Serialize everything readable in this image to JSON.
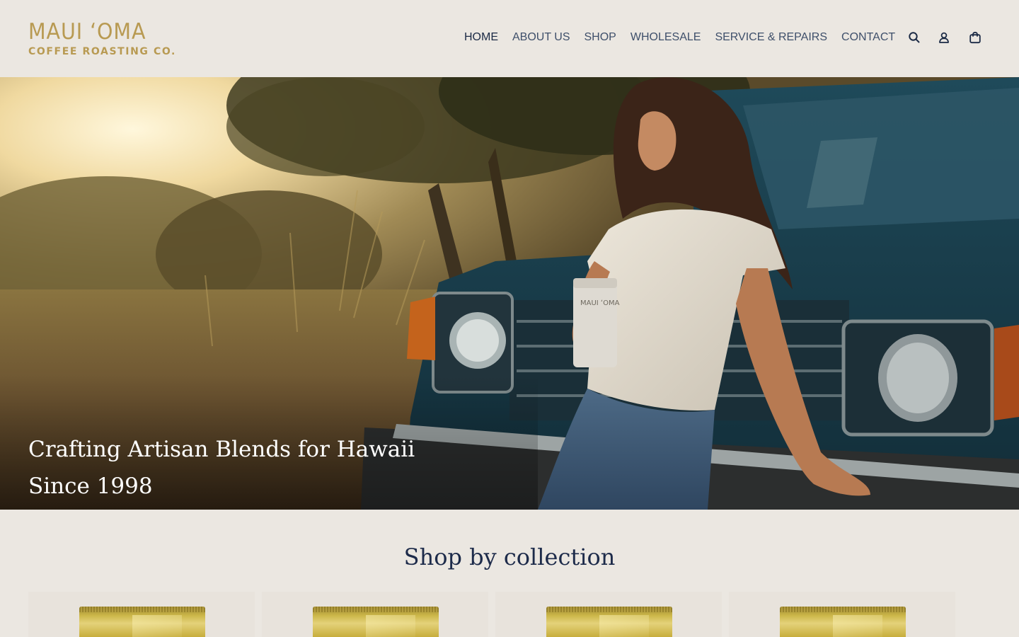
{
  "brand": {
    "line1": "MAUI ʻOMA",
    "line2": "COFFEE ROASTING CO."
  },
  "nav": {
    "items": [
      {
        "label": "HOME",
        "active": true
      },
      {
        "label": "ABOUT US",
        "active": false
      },
      {
        "label": "SHOP",
        "active": false
      },
      {
        "label": "WHOLESALE",
        "active": false
      },
      {
        "label": "SERVICE & REPAIRS",
        "active": false
      },
      {
        "label": "CONTACT",
        "active": false
      }
    ],
    "icons": [
      "search-icon",
      "account-icon",
      "cart-icon"
    ]
  },
  "hero": {
    "headline_line1": "Crafting Artisan Blends for Hawaii",
    "headline_line2": "Since 1998",
    "tumbler_text": "MAUI ʻOMA"
  },
  "collections": {
    "title": "Shop by collection",
    "items": [
      {
        "image": "gold-coffee-bag"
      },
      {
        "image": "gold-coffee-bag"
      },
      {
        "image": "gold-coffee-bag"
      },
      {
        "image": "gold-coffee-bag"
      }
    ]
  },
  "colors": {
    "background": "#ebe7e1",
    "brand_gold": "#b89a52",
    "nav_text": "#3e4f6a",
    "heading_navy": "#1d2b4a"
  }
}
